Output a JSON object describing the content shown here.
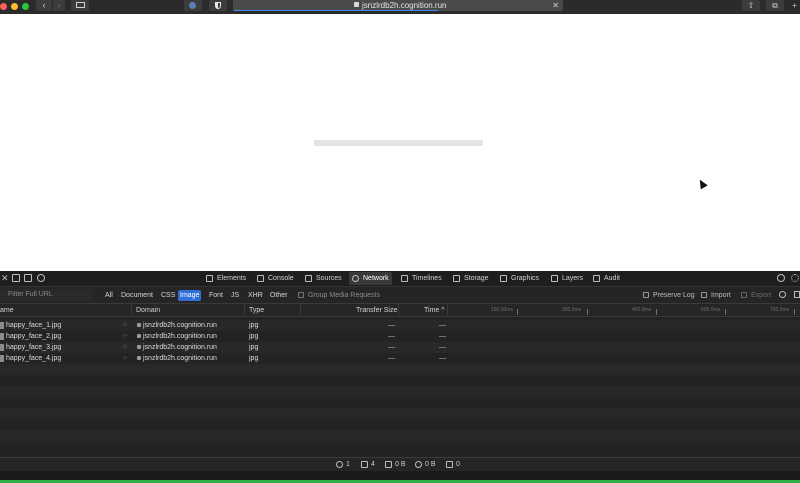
{
  "browser": {
    "url": "jsnzlrdb2h.cognition.run",
    "close_glyph": "✕",
    "back_glyph": "‹",
    "fwd_glyph": "›",
    "share_glyph": "⇧",
    "tabs_glyph": "⧉",
    "newtab_glyph": "+",
    "loading_progress_fraction": 0.62
  },
  "devtools": {
    "tabs": [
      {
        "label": "Elements",
        "icon": "elements-icon"
      },
      {
        "label": "Console",
        "icon": "console-icon"
      },
      {
        "label": "Sources",
        "icon": "sources-icon"
      },
      {
        "label": "Network",
        "icon": "network-icon",
        "active": true
      },
      {
        "label": "Timelines",
        "icon": "timelines-icon"
      },
      {
        "label": "Storage",
        "icon": "storage-icon"
      },
      {
        "label": "Graphics",
        "icon": "graphics-icon"
      },
      {
        "label": "Layers",
        "icon": "layers-icon"
      },
      {
        "label": "Audit",
        "icon": "audit-icon"
      }
    ],
    "filter": {
      "placeholder": "Filter Full URL",
      "types": [
        "All",
        "Document",
        "CSS",
        "Image",
        "Font",
        "JS",
        "XHR",
        "Other"
      ],
      "active_type": "Image",
      "group_media": "Group Media Requests",
      "preserve_log": "Preserve Log",
      "import": "Import",
      "export": "Export"
    },
    "columns": {
      "name": "ame",
      "domain": "Domain",
      "type": "Type",
      "transfer_size": "Transfer Size",
      "time": "Time ^"
    },
    "timeline_ticks": [
      "150.00ms",
      "300.0ms",
      "450.0ms",
      "600.0ms",
      "750.0ms"
    ],
    "requests": [
      {
        "name": "happy_face_1.jpg",
        "domain": "jsnzlrdb2h.cognition.run",
        "type": "jpg",
        "size": "—",
        "time": "—"
      },
      {
        "name": "happy_face_2.jpg",
        "domain": "jsnzlrdb2h.cognition.run",
        "type": "jpg",
        "size": "—",
        "time": "—"
      },
      {
        "name": "happy_face_3.jpg",
        "domain": "jsnzlrdb2h.cognition.run",
        "type": "jpg",
        "size": "—",
        "time": "—"
      },
      {
        "name": "happy_face_4.jpg",
        "domain": "jsnzlrdb2h.cognition.run",
        "type": "jpg",
        "size": "—",
        "time": "—"
      }
    ],
    "spinner_glyph": "⁘",
    "status": {
      "requests": "1",
      "resources": "4",
      "transferred": "0 B",
      "size": "0 B",
      "time": "0"
    }
  }
}
